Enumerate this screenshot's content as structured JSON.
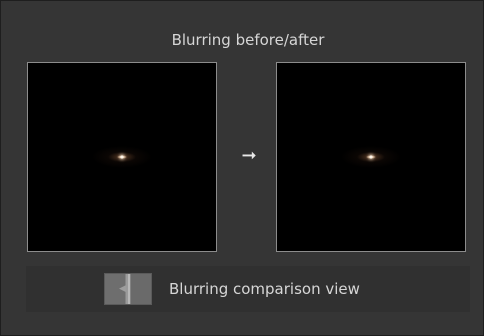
{
  "panel": {
    "title": "Blurring before/after",
    "arrow_glyph": "➞"
  },
  "preview_before": {
    "icon": "star-point-icon"
  },
  "preview_after": {
    "icon": "star-point-icon"
  },
  "comparison": {
    "label": "Blurring comparison view",
    "toggle_icon": "split-compare-icon"
  },
  "colors": {
    "panel_bg": "#353535",
    "preview_bg": "#000000",
    "text": "#d6d6d6",
    "preview_border": "#8c8c8c"
  }
}
